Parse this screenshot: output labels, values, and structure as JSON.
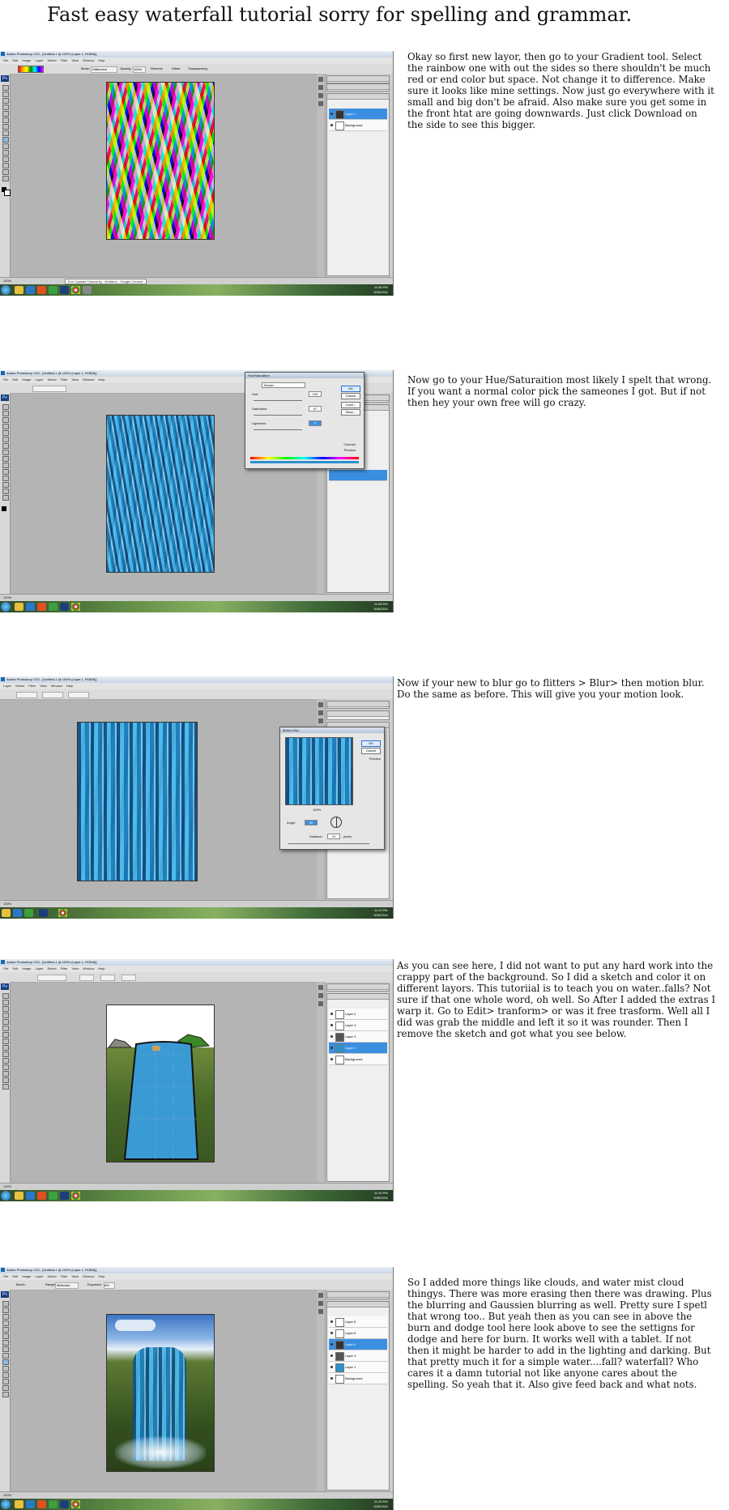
{
  "page": {
    "title": "Fast easy waterfall tutorial sorry for spelling and grammar."
  },
  "ps": {
    "menu": [
      "File",
      "Edit",
      "Image",
      "Layer",
      "Select",
      "Filter",
      "View",
      "Window",
      "Help"
    ]
  },
  "steps": [
    {
      "window_title": "Adobe Photoshop CS3 - [Untitled-1 @ 100% (Layer 1, RGB/8)]",
      "status": "100%",
      "taskbar_tab": "Eve Crystals Tutorial by ~Emiliano - Google Chrome",
      "clock_time": "11:06 PM",
      "clock_date": "5/26/2011",
      "options": [
        "Mode:",
        "Difference",
        "Opacity:",
        "100%",
        "Reverse",
        "Dither",
        "Transparency"
      ],
      "layers": [
        "Layer 1",
        "Background"
      ],
      "description": "Okay so first new layor, then go to your Gradient tool. Select the rainbow one with out the sides so there shouldn't be much red or end color but space. Not change it to difference. Make sure it looks like mine settings. Now just go everywhere with it small and big don't be afraid. Also make sure you get some in the front htat are going downwards. Just click Download on the side to see this bigger."
    },
    {
      "window_title": "Adobe Photoshop CS3 - [Untitled-1 @ 100% (Layer 1, RGB/8)]",
      "status": "100%",
      "clock_time": "11:08 PM",
      "clock_date": "5/26/2011",
      "dialog_title": "Hue/Saturation",
      "dialog_preset": "Master",
      "hue_label": "Hue:",
      "hue_value": "195",
      "saturation_label": "Saturation:",
      "saturation_value": "67",
      "lightness_label": "Lightness:",
      "lightness_value": "0",
      "buttons": [
        "OK",
        "Cancel",
        "Load...",
        "Save..."
      ],
      "colorize": "Colorize",
      "preview": "Preview",
      "description": "Now go to your Hue/Saturaition most likely I spelt that wrong. If you want a normal color pick the sameones I got. But if not then hey your own free will go crazy."
    },
    {
      "window_title": "Adobe Photoshop CS3 - [Untitled-1 @ 100% (Layer 1, RGB/8)]",
      "status": "100%",
      "clock_time": "11:11 PM",
      "clock_date": "5/26/2011",
      "dialog_title": "Motion Blur",
      "zoom": "100%",
      "angle_label": "Angle:",
      "angle_value": "90",
      "distance_label": "Distance:",
      "distance_value": "24",
      "distance_unit": "pixels",
      "buttons": [
        "OK",
        "Cancel"
      ],
      "preview": "Preview",
      "description": "Now if your new to blur go to flitters > Blur> then motion blur. Do the same as before. This will give you your motion look."
    },
    {
      "window_title": "Adobe Photoshop CS3 - [Untitled-1 @ 100% (Layer 1, RGB/8)]",
      "status": "100%",
      "clock_time": "11:16 PM",
      "clock_date": "5/26/2011",
      "layers": [
        "Layer 2",
        "Layer 4",
        "Layer 3",
        "Layer 1",
        "Background"
      ],
      "description": "As you can see here, I did not want to put any hard work into the crappy part of the background. So I did a sketch and color it on different layors. This tutoriial is to teach you on water..falls? Not sure if that one whole word, oh well. So After I added the extras I warp it. Go to Edit> tranform> or was it free trasform. Well all I did was grab the middle and left it so it was rounder. Then I remove the sketch and got what you see below."
    },
    {
      "window_title": "Adobe Photoshop CS3 - [Untitled-1 @ 100% (Layer 1, RGB/8)]",
      "status": "100%",
      "clock_time": "11:25 PM",
      "clock_date": "5/26/2011",
      "options": [
        "Brush:",
        "Range:",
        "Midtones",
        "Exposure:",
        "8%"
      ],
      "layers": [
        "Layer 6",
        "Layer 6",
        "Layer 5",
        "Layer 3",
        "Layer 1",
        "Background"
      ],
      "description": "So I added more things like clouds, and water mist cloud thingys. There was more erasing then there was drawing. Plus the blurring and Gaussien blurring as well. Pretty sure I spetl that wrong too.. But yeah then as you can see in above the burn and dodge tool here look above to see the settigns for dodge and here for burn. It works well with a tablet. If not then it might be harder to add in the lighting and darking. But that pretty much it for a simple water....fall? waterfall? Who cares it a damn tutorial not like anyone cares about the spelling. So yeah that it. Also give feed back and what nots."
    }
  ]
}
